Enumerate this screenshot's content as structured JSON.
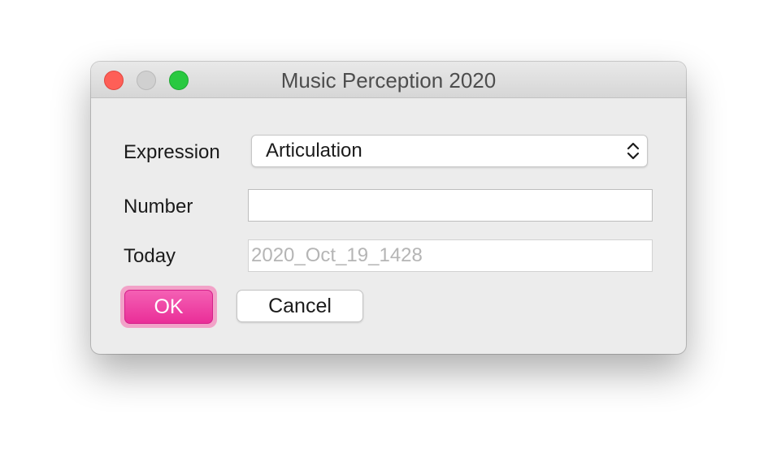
{
  "window": {
    "title": "Music Perception 2020"
  },
  "form": {
    "expression": {
      "label": "Expression",
      "selected": "Articulation"
    },
    "number": {
      "label": "Number",
      "value": ""
    },
    "today": {
      "label": "Today",
      "value": "2020_Oct_19_1428"
    }
  },
  "buttons": {
    "ok_label": "OK",
    "cancel_label": "Cancel"
  },
  "colors": {
    "close": "#fe5f57",
    "minimize_inactive": "#d0d0d0",
    "maximize": "#29c940",
    "accent": "#ea2e98",
    "window_bg": "#ececec"
  },
  "icons": {
    "select_arrows": "chevron-up-down-icon"
  }
}
